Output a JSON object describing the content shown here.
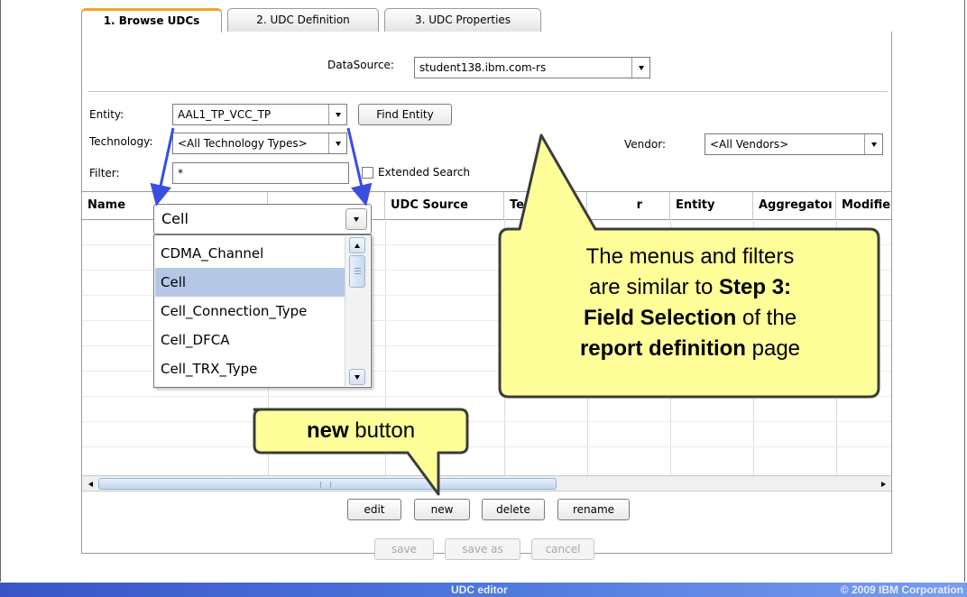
{
  "tabs": [
    {
      "label": "1. Browse UDCs"
    },
    {
      "label": "2. UDC Definition"
    },
    {
      "label": "3. UDC Properties"
    }
  ],
  "datasource": {
    "label": "DataSource:",
    "value": "student138.ibm.com-rs"
  },
  "entity": {
    "label": "Entity:",
    "value": "AAL1_TP_VCC_TP",
    "find_button": "Find Entity"
  },
  "technology": {
    "label": "Technology:",
    "value": "<All Technology Types>"
  },
  "vendor": {
    "label": "Vendor:",
    "value": "<All Vendors>"
  },
  "filter": {
    "label": "Filter:",
    "value": "*",
    "extended_search_label": "Extended Search"
  },
  "table": {
    "columns": [
      "Name",
      "UDC Source",
      "Techno",
      "r",
      "Entity",
      "Aggregatoı",
      "Modifie"
    ]
  },
  "cell_dropdown": {
    "value": "Cell",
    "options": [
      "CDMA_Channel",
      "Cell",
      "Cell_Connection_Type",
      "Cell_DFCA",
      "Cell_TRX_Type"
    ],
    "selected_index": 1
  },
  "actions": {
    "edit": "edit",
    "new": "new",
    "delete": "delete",
    "rename": "rename"
  },
  "footer_actions": {
    "save": "save",
    "save_as": "save as",
    "cancel": "cancel"
  },
  "callouts": {
    "menus": {
      "line1": "The menus and filters",
      "line2a": "are similar to ",
      "line2b": "Step 3:",
      "line3a": "Field Selection",
      "line3b": " of the",
      "line4a": "report definition",
      "line4b": " page"
    },
    "new_button": {
      "bold": "new",
      "rest": " button"
    }
  },
  "bottom_bar": {
    "title": "UDC editor",
    "copyright": "© 2009 IBM Corporation"
  },
  "colors": {
    "callout_fill": "#ffff99",
    "callout_border": "#3c3c3c",
    "arrow_blue": "#3a4ee0",
    "selected_row": "#b4c8e6",
    "tab_accent": "#f5a623"
  }
}
